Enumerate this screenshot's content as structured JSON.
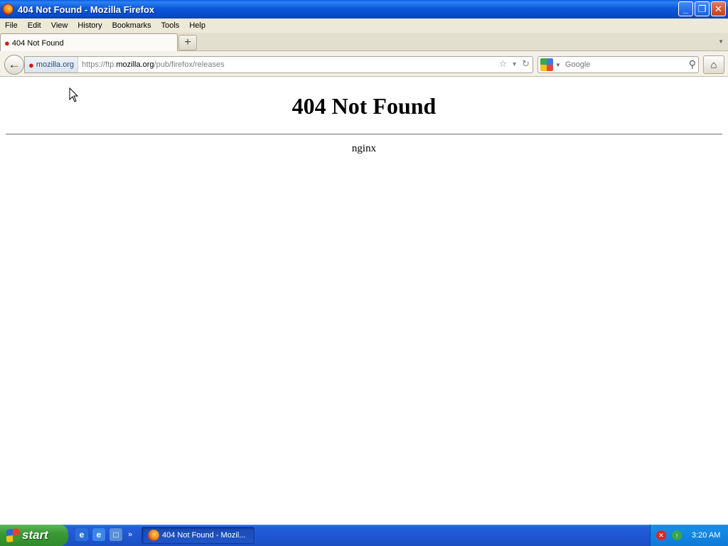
{
  "window": {
    "title": "404 Not Found - Mozilla Firefox",
    "controls": {
      "minimize": "_",
      "restore": "❐",
      "close": "✕"
    }
  },
  "menu": [
    "File",
    "Edit",
    "View",
    "History",
    "Bookmarks",
    "Tools",
    "Help"
  ],
  "tabs": [
    {
      "title": "404 Not Found",
      "icon": "site-favicon",
      "active": true
    }
  ],
  "navbar": {
    "back_icon": "back-arrow-icon",
    "identity": "mozilla.org",
    "url_prefix": "https://ftp.",
    "url_host": "mozilla.org",
    "url_path": "/pub/firefox/releases",
    "search_placeholder": "Google",
    "home_icon": "home-icon"
  },
  "page": {
    "heading": "404 Not Found",
    "server": "nginx"
  },
  "taskbar": {
    "start_label": "start",
    "task_title": "404 Not Found - Mozil...",
    "clock": "3:20 AM",
    "quick_launch": [
      "ie-icon",
      "firefox-icon",
      "show-desktop-icon"
    ]
  },
  "colors": {
    "titlebar": "#0b58d8",
    "start_button": "#3a9a35",
    "taskbar": "#245edb",
    "tray": "#1690e8"
  }
}
